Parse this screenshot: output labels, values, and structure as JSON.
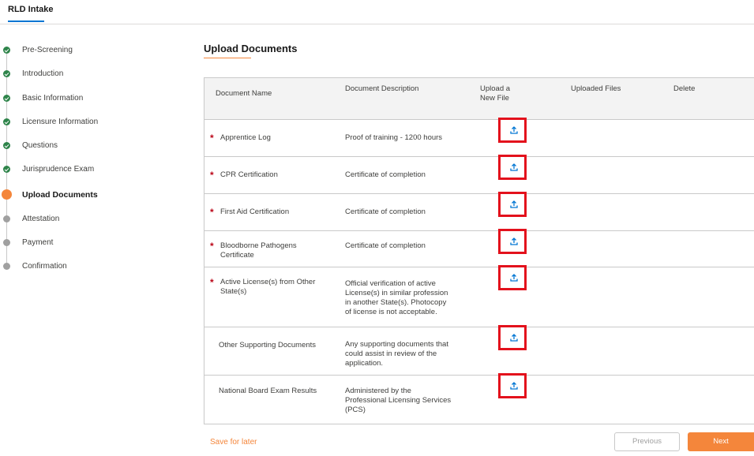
{
  "app": {
    "title": "RLD Intake"
  },
  "steps": [
    {
      "label": "Pre-Screening",
      "status": "complete"
    },
    {
      "label": "Introduction",
      "status": "complete"
    },
    {
      "label": "Basic Information",
      "status": "complete"
    },
    {
      "label": "Licensure Information",
      "status": "complete"
    },
    {
      "label": "Questions",
      "status": "complete"
    },
    {
      "label": "Jurisprudence Exam",
      "status": "complete"
    },
    {
      "label": "Upload Documents",
      "status": "current"
    },
    {
      "label": "Attestation",
      "status": "pending"
    },
    {
      "label": "Payment",
      "status": "pending"
    },
    {
      "label": "Confirmation",
      "status": "pending"
    }
  ],
  "main": {
    "title": "Upload Documents",
    "table": {
      "headers": {
        "name": "Document Name",
        "description": "Document Description",
        "upload": "Upload a New File",
        "uploaded": "Uploaded Files",
        "delete": "Delete"
      },
      "rows": [
        {
          "required": true,
          "name": "Apprentice Log",
          "description": "Proof of training - 1200 hours"
        },
        {
          "required": true,
          "name": "CPR Certification",
          "description": "Certificate of completion"
        },
        {
          "required": true,
          "name": "First Aid Certification",
          "description": "Certificate of completion"
        },
        {
          "required": true,
          "name": "Bloodborne Pathogens Certificate",
          "description": "Certificate of completion"
        },
        {
          "required": true,
          "name": "Active License(s) from Other State(s)",
          "description": "Official verification of active License(s) in similar profession in another State(s). Photocopy of license is not acceptable."
        },
        {
          "required": false,
          "name": "Other Supporting Documents",
          "description": "Any supporting documents that could assist in review of the application."
        },
        {
          "required": false,
          "name": "National Board Exam Results",
          "description": "Administered by the Professional Licensing Services (PCS)"
        }
      ],
      "required_marker": "*"
    }
  },
  "footer": {
    "save_label": "Save for later",
    "previous_label": "Previous",
    "next_label": "Next"
  },
  "colors": {
    "accent": "#f4863b",
    "complete": "#2e844a",
    "required": "#ba0517",
    "upload_icon": "#0176d3",
    "highlight": "#e3111c"
  },
  "icons": {
    "upload": "upload-icon",
    "check": "check-icon"
  }
}
